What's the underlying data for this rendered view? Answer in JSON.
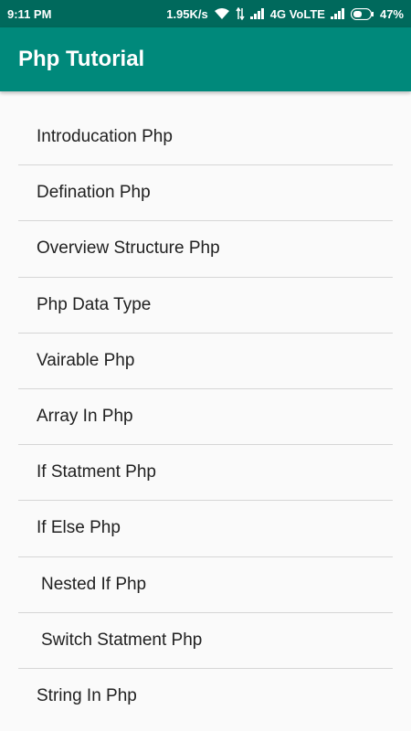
{
  "status_bar": {
    "time": "9:11 PM",
    "speed": "1.95K/s",
    "network": "4G VoLTE",
    "battery": "47%"
  },
  "app_bar": {
    "title": "Php Tutorial"
  },
  "list": {
    "items": [
      {
        "label": "Introducation Php"
      },
      {
        "label": "Defination Php"
      },
      {
        "label": "Overview Structure Php"
      },
      {
        "label": "Php Data Type"
      },
      {
        "label": "Vairable Php"
      },
      {
        "label": "Array In Php"
      },
      {
        "label": "If Statment Php"
      },
      {
        "label": "If Else Php"
      },
      {
        "label": "Nested If Php"
      },
      {
        "label": "Switch Statment Php"
      },
      {
        "label": "String In Php"
      }
    ]
  },
  "colors": {
    "app_bar": "#00897b",
    "status_bar": "#00695c",
    "background": "#fafafa",
    "divider": "#d6d6d6"
  }
}
